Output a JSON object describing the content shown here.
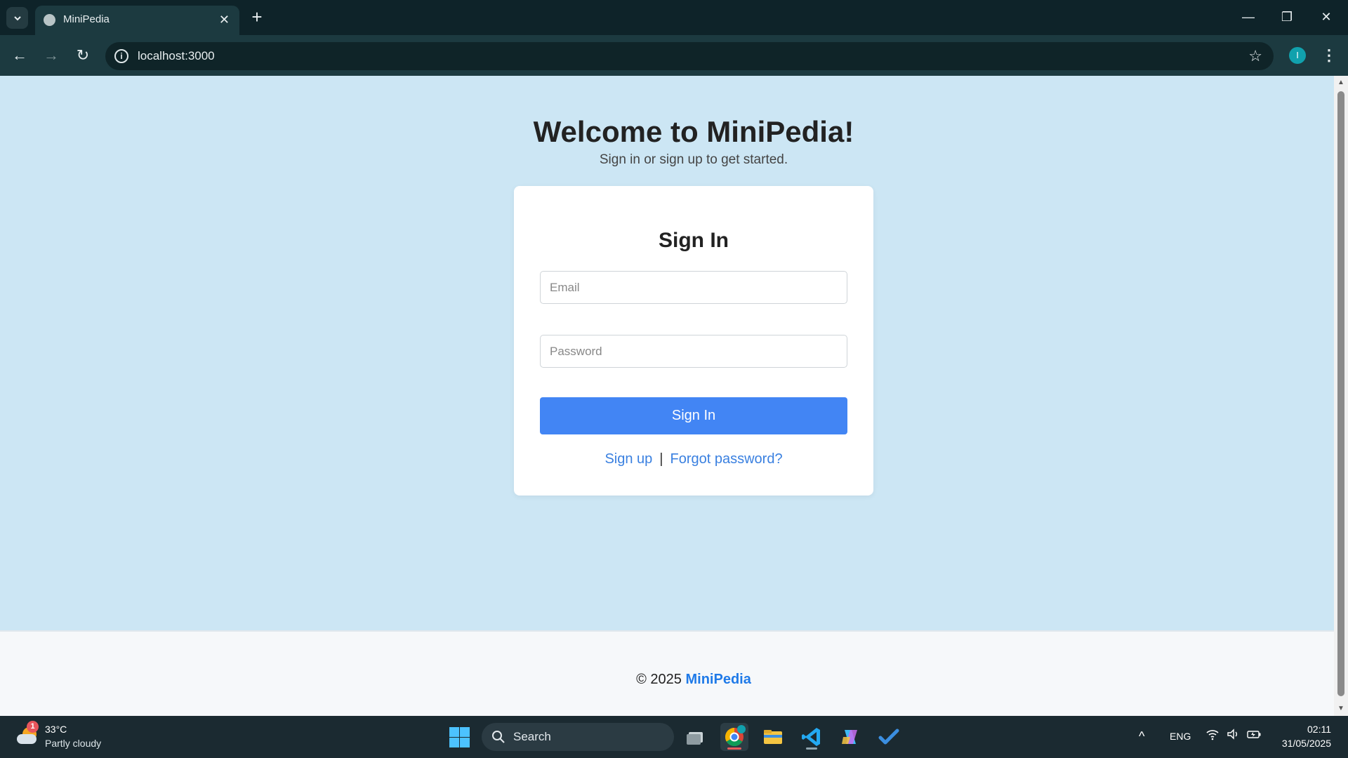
{
  "browser": {
    "tab": {
      "title": "MiniPedia",
      "close_glyph": "✕"
    },
    "new_tab_glyph": "+",
    "window_controls": {
      "minimize": "—",
      "restore": "❐",
      "close": "✕"
    },
    "nav": {
      "back": "←",
      "forward": "→",
      "reload": "↻"
    },
    "address": {
      "info_glyph": "i",
      "url": "localhost:3000",
      "star_glyph": "☆"
    },
    "profile_initial": "I",
    "menu_glyph": "⋮"
  },
  "page": {
    "hero": {
      "title": "Welcome to MiniPedia!",
      "subtitle": "Sign in or sign up to get started."
    },
    "signin_card": {
      "title": "Sign In",
      "email_placeholder": "Email",
      "password_placeholder": "Password",
      "submit_label": "Sign In",
      "signup_link": "Sign up",
      "separator": "|",
      "forgot_link": "Forgot password?"
    },
    "footer": {
      "copyright": "© 2025",
      "brand": "MiniPedia"
    },
    "colors": {
      "background": "#cce6f4",
      "primary_button": "#4285f4",
      "link": "#3a80e0",
      "footer_brand": "#1f7ae8"
    }
  },
  "taskbar": {
    "weather": {
      "temperature": "33°C",
      "condition": "Partly cloudy",
      "badge": "1"
    },
    "search_label": "Search",
    "apps": [
      "task-view-icon",
      "chrome-icon",
      "file-explorer-icon",
      "vscode-icon",
      "copilot-icon",
      "todo-icon"
    ],
    "tray": {
      "chevron": "^",
      "language": "ENG",
      "time": "02:11",
      "date": "31/05/2025"
    }
  }
}
